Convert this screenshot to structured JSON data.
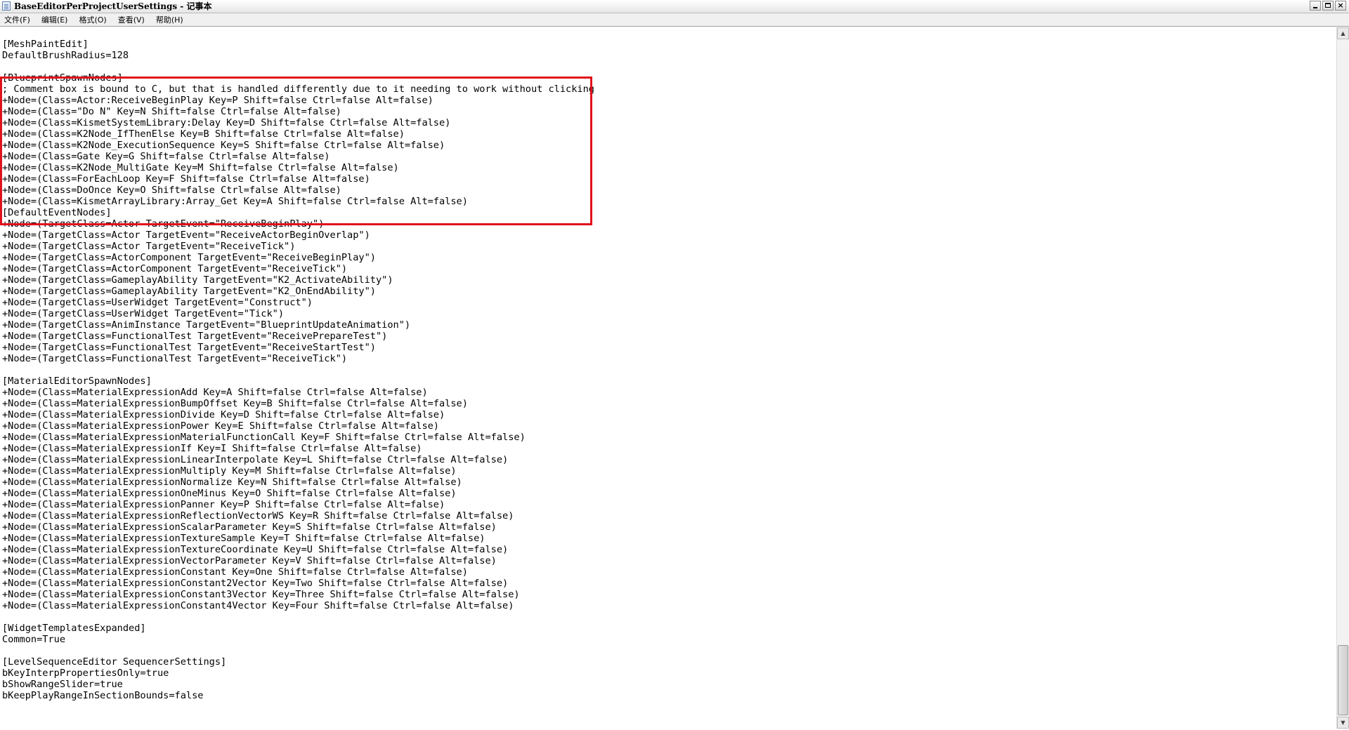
{
  "window": {
    "title": "BaseEditorPerProjectUserSettings - 记事本"
  },
  "menu": [
    {
      "label": "文件(F)"
    },
    {
      "label": "编辑(E)"
    },
    {
      "label": "格式(O)"
    },
    {
      "label": "查看(V)"
    },
    {
      "label": "帮助(H)"
    }
  ],
  "window_controls": {
    "close_glyph": "×"
  },
  "scrollbar": {
    "up_glyph": "▲",
    "down_glyph": "▼"
  },
  "highlight": {
    "color": "#e0111b"
  },
  "text_lines": [
    "[MeshPaintEdit]",
    "DefaultBrushRadius=128",
    "",
    "[BlueprintSpawnNodes]",
    "; Comment box is bound to C, but that is handled differently due to it needing to work without clicking",
    "+Node=(Class=Actor:ReceiveBeginPlay Key=P Shift=false Ctrl=false Alt=false)",
    "+Node=(Class=\"Do N\" Key=N Shift=false Ctrl=false Alt=false)",
    "+Node=(Class=KismetSystemLibrary:Delay Key=D Shift=false Ctrl=false Alt=false)",
    "+Node=(Class=K2Node_IfThenElse Key=B Shift=false Ctrl=false Alt=false)",
    "+Node=(Class=K2Node_ExecutionSequence Key=S Shift=false Ctrl=false Alt=false)",
    "+Node=(Class=Gate Key=G Shift=false Ctrl=false Alt=false)",
    "+Node=(Class=K2Node_MultiGate Key=M Shift=false Ctrl=false Alt=false)",
    "+Node=(Class=ForEachLoop Key=F Shift=false Ctrl=false Alt=false)",
    "+Node=(Class=DoOnce Key=O Shift=false Ctrl=false Alt=false)",
    "+Node=(Class=KismetArrayLibrary:Array_Get Key=A Shift=false Ctrl=false Alt=false)",
    "[DefaultEventNodes]",
    "+Node=(TargetClass=Actor TargetEvent=\"ReceiveBeginPlay\")",
    "+Node=(TargetClass=Actor TargetEvent=\"ReceiveActorBeginOverlap\")",
    "+Node=(TargetClass=Actor TargetEvent=\"ReceiveTick\")",
    "+Node=(TargetClass=ActorComponent TargetEvent=\"ReceiveBeginPlay\")",
    "+Node=(TargetClass=ActorComponent TargetEvent=\"ReceiveTick\")",
    "+Node=(TargetClass=GameplayAbility TargetEvent=\"K2_ActivateAbility\")",
    "+Node=(TargetClass=GameplayAbility TargetEvent=\"K2_OnEndAbility\")",
    "+Node=(TargetClass=UserWidget TargetEvent=\"Construct\")",
    "+Node=(TargetClass=UserWidget TargetEvent=\"Tick\")",
    "+Node=(TargetClass=AnimInstance TargetEvent=\"BlueprintUpdateAnimation\")",
    "+Node=(TargetClass=FunctionalTest TargetEvent=\"ReceivePrepareTest\")",
    "+Node=(TargetClass=FunctionalTest TargetEvent=\"ReceiveStartTest\")",
    "+Node=(TargetClass=FunctionalTest TargetEvent=\"ReceiveTick\")",
    "",
    "[MaterialEditorSpawnNodes]",
    "+Node=(Class=MaterialExpressionAdd Key=A Shift=false Ctrl=false Alt=false)",
    "+Node=(Class=MaterialExpressionBumpOffset Key=B Shift=false Ctrl=false Alt=false)",
    "+Node=(Class=MaterialExpressionDivide Key=D Shift=false Ctrl=false Alt=false)",
    "+Node=(Class=MaterialExpressionPower Key=E Shift=false Ctrl=false Alt=false)",
    "+Node=(Class=MaterialExpressionMaterialFunctionCall Key=F Shift=false Ctrl=false Alt=false)",
    "+Node=(Class=MaterialExpressionIf Key=I Shift=false Ctrl=false Alt=false)",
    "+Node=(Class=MaterialExpressionLinearInterpolate Key=L Shift=false Ctrl=false Alt=false)",
    "+Node=(Class=MaterialExpressionMultiply Key=M Shift=false Ctrl=false Alt=false)",
    "+Node=(Class=MaterialExpressionNormalize Key=N Shift=false Ctrl=false Alt=false)",
    "+Node=(Class=MaterialExpressionOneMinus Key=O Shift=false Ctrl=false Alt=false)",
    "+Node=(Class=MaterialExpressionPanner Key=P Shift=false Ctrl=false Alt=false)",
    "+Node=(Class=MaterialExpressionReflectionVectorWS Key=R Shift=false Ctrl=false Alt=false)",
    "+Node=(Class=MaterialExpressionScalarParameter Key=S Shift=false Ctrl=false Alt=false)",
    "+Node=(Class=MaterialExpressionTextureSample Key=T Shift=false Ctrl=false Alt=false)",
    "+Node=(Class=MaterialExpressionTextureCoordinate Key=U Shift=false Ctrl=false Alt=false)",
    "+Node=(Class=MaterialExpressionVectorParameter Key=V Shift=false Ctrl=false Alt=false)",
    "+Node=(Class=MaterialExpressionConstant Key=One Shift=false Ctrl=false Alt=false)",
    "+Node=(Class=MaterialExpressionConstant2Vector Key=Two Shift=false Ctrl=false Alt=false)",
    "+Node=(Class=MaterialExpressionConstant3Vector Key=Three Shift=false Ctrl=false Alt=false)",
    "+Node=(Class=MaterialExpressionConstant4Vector Key=Four Shift=false Ctrl=false Alt=false)",
    "",
    "[WidgetTemplatesExpanded]",
    "Common=True",
    "",
    "[LevelSequenceEditor SequencerSettings]",
    "bKeyInterpPropertiesOnly=true",
    "bShowRangeSlider=true",
    "bKeepPlayRangeInSectionBounds=false"
  ]
}
